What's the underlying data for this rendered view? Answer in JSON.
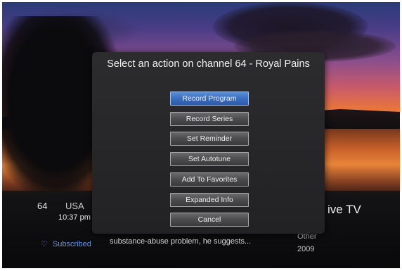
{
  "dialog": {
    "title": "Select an action on channel 64 - Royal Pains",
    "buttons": [
      {
        "label": "Record Program",
        "selected": true
      },
      {
        "label": "Record Series",
        "selected": false
      },
      {
        "label": "Set Reminder",
        "selected": false
      },
      {
        "label": "Set Autotune",
        "selected": false
      },
      {
        "label": "Add To Favorites",
        "selected": false
      },
      {
        "label": "Expanded Info",
        "selected": false
      },
      {
        "label": "Cancel",
        "selected": false
      }
    ]
  },
  "info": {
    "channel": "64",
    "network": "USA",
    "time": "10:37 pm",
    "title_fragment": "ive TV",
    "description": "substance-abuse problem, he suggests...",
    "genre": "Other",
    "year": "2009",
    "subscribed": "Subscribed",
    "icons": {
      "subscribed": "heart-icon"
    }
  },
  "colors": {
    "accent": "#3a6ec0",
    "link": "#6f95d8"
  }
}
